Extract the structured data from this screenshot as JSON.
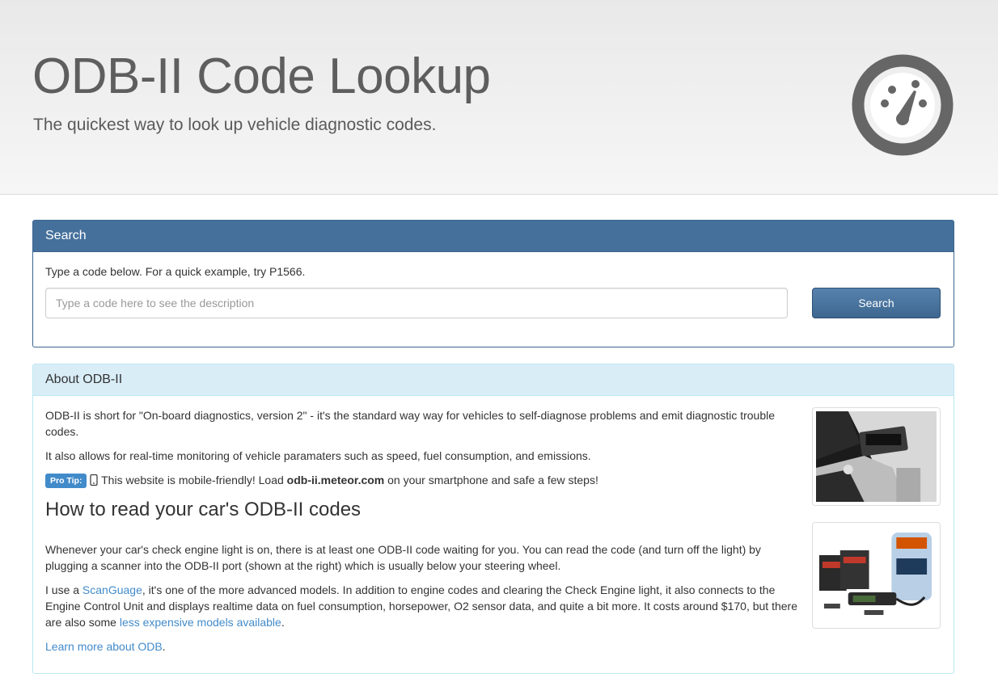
{
  "hero": {
    "title": "ODB-II Code Lookup",
    "subtitle": "The quickest way to look up vehicle diagnostic codes.",
    "icon": "dashboard-gauge-icon"
  },
  "search_panel": {
    "heading": "Search",
    "hint": "Type a code below. For a quick example, try P1566.",
    "input_placeholder": "Type a code here to see the description",
    "input_value": "",
    "button_label": "Search"
  },
  "about_panel": {
    "heading": "About ODB-II",
    "para1": "ODB-II is short for \"On-board diagnostics, version 2\" - it's the standard way way for vehicles to self-diagnose problems and emit diagnostic trouble codes.",
    "para2": "It also allows for real-time monitoring of vehicle paramaters such as speed, fuel consumption, and emissions.",
    "protip": {
      "label": "Pro Tip:",
      "icon": "mobile-phone-icon",
      "text_before": " This website is mobile-friendly! Load ",
      "domain": "odb-ii.meteor.com",
      "text_after": " on your smartphone and safe a few steps!"
    },
    "howto_heading": "How to read your car's ODB-II codes",
    "para3": "Whenever your car's check engine light is on, there is at least one ODB-II code waiting for you. You can read the code (and turn off the light) by plugging a scanner into the ODB-II port (shown at the right) which is usually below your steering wheel.",
    "para4": {
      "before": "I use a ",
      "link1": "ScanGuage",
      "middle": ", it's one of the more advanced models. In addition to engine codes and clearing the Check Engine light, it also connects to the Engine Control Unit and displays realtime data on fuel consumption, horsepower, O2 sensor data, and quite a bit more. It costs around $170, but there are also some ",
      "link2": "less expensive models available",
      "after": "."
    },
    "learn_more_link": "Learn more about ODB",
    "learn_more_after": "."
  },
  "colors": {
    "primary_panel": "#45709b",
    "info_panel": "#d9edf7",
    "link": "#428bca",
    "label_primary": "#428bca",
    "gauge": "#666666"
  }
}
